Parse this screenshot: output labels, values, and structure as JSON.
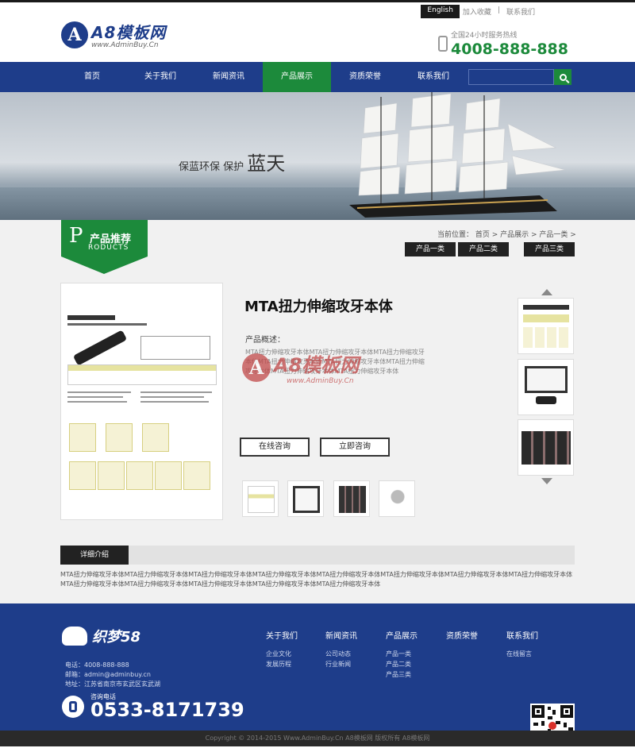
{
  "header": {
    "logo_title": "A8模板网",
    "logo_sub": "www.AdminBuy.Cn",
    "lang_en": "English",
    "lang_links": [
      "加入收藏",
      "|",
      "联系我们"
    ],
    "hotline_label": "全国24小时服务热线",
    "hotline_number": "4008-888-888"
  },
  "nav": {
    "items": [
      "首页",
      "关于我们",
      "新闻资讯",
      "产品展示",
      "资质荣誉",
      "联系我们"
    ],
    "active_index": 3,
    "search_placeholder": ""
  },
  "banner": {
    "slogan_small": "保蓝环保  保护",
    "slogan_big": "蓝天"
  },
  "section": {
    "badge_cn": "产品推荐",
    "badge_en": "RODUCTS",
    "badge_letter": "P",
    "breadcrumb": "当前位置： 首页 >  产品展示 >  产品一类 >",
    "subcats": [
      "产品一类",
      "产品二类",
      "产品三类"
    ]
  },
  "product": {
    "title": "MTA扭力伸缩攻牙本体",
    "desc_label": "产品概述：",
    "desc_text": "MTA扭力伸缩攻牙本体MTA扭力伸缩攻牙本体MTA扭力伸缩攻牙本体MTA扭力伸缩攻牙本体MTA扭力伸缩攻牙本体MTA扭力伸缩攻牙本体MTA扭力伸缩攻牙本体MTA扭力伸缩攻牙本体",
    "btn_online": "在线咨询",
    "btn_now": "立即咨询",
    "watermark_title": "A8模板网",
    "watermark_sub": "www.AdminBuy.Cn"
  },
  "detail": {
    "tab_label": "详细介绍",
    "text": "MTA扭力伸缩攻牙本体MTA扭力伸缩攻牙本体MTA扭力伸缩攻牙本体MTA扭力伸缩攻牙本体MTA扭力伸缩攻牙本体MTA扭力伸缩攻牙本体MTA扭力伸缩攻牙本体MTA扭力伸缩攻牙本体MTA扭力伸缩攻牙本体MTA扭力伸缩攻牙本体MTA扭力伸缩攻牙本体MTA扭力伸缩攻牙本体MTA扭力伸缩攻牙本体"
  },
  "footer": {
    "logo_text": "织梦58",
    "info": [
      "电话：4008-888-888",
      "邮箱：admin@adminbuy.cn",
      "地址：江苏省南京市玄武区玄武湖"
    ],
    "phone_label": "咨询电话",
    "phone_number": "0533-8171739",
    "columns": [
      {
        "title": "关于我们",
        "items": [
          "企业文化",
          "发展历程"
        ]
      },
      {
        "title": "新闻资讯",
        "items": [
          "公司动态",
          "行业新闻"
        ]
      },
      {
        "title": "产品展示",
        "items": [
          "产品一类",
          "产品二类",
          "产品三类"
        ]
      },
      {
        "title": "资质荣誉",
        "items": []
      },
      {
        "title": "联系我们",
        "items": [
          "在线留言"
        ]
      }
    ],
    "copyright": "Copyright © 2014-2015 Www.AdminBuy.Cn A8模板网 版权所有   A8模板网"
  },
  "colors": {
    "primary_blue": "#1e3d8a",
    "accent_green": "#1c8a3b"
  }
}
